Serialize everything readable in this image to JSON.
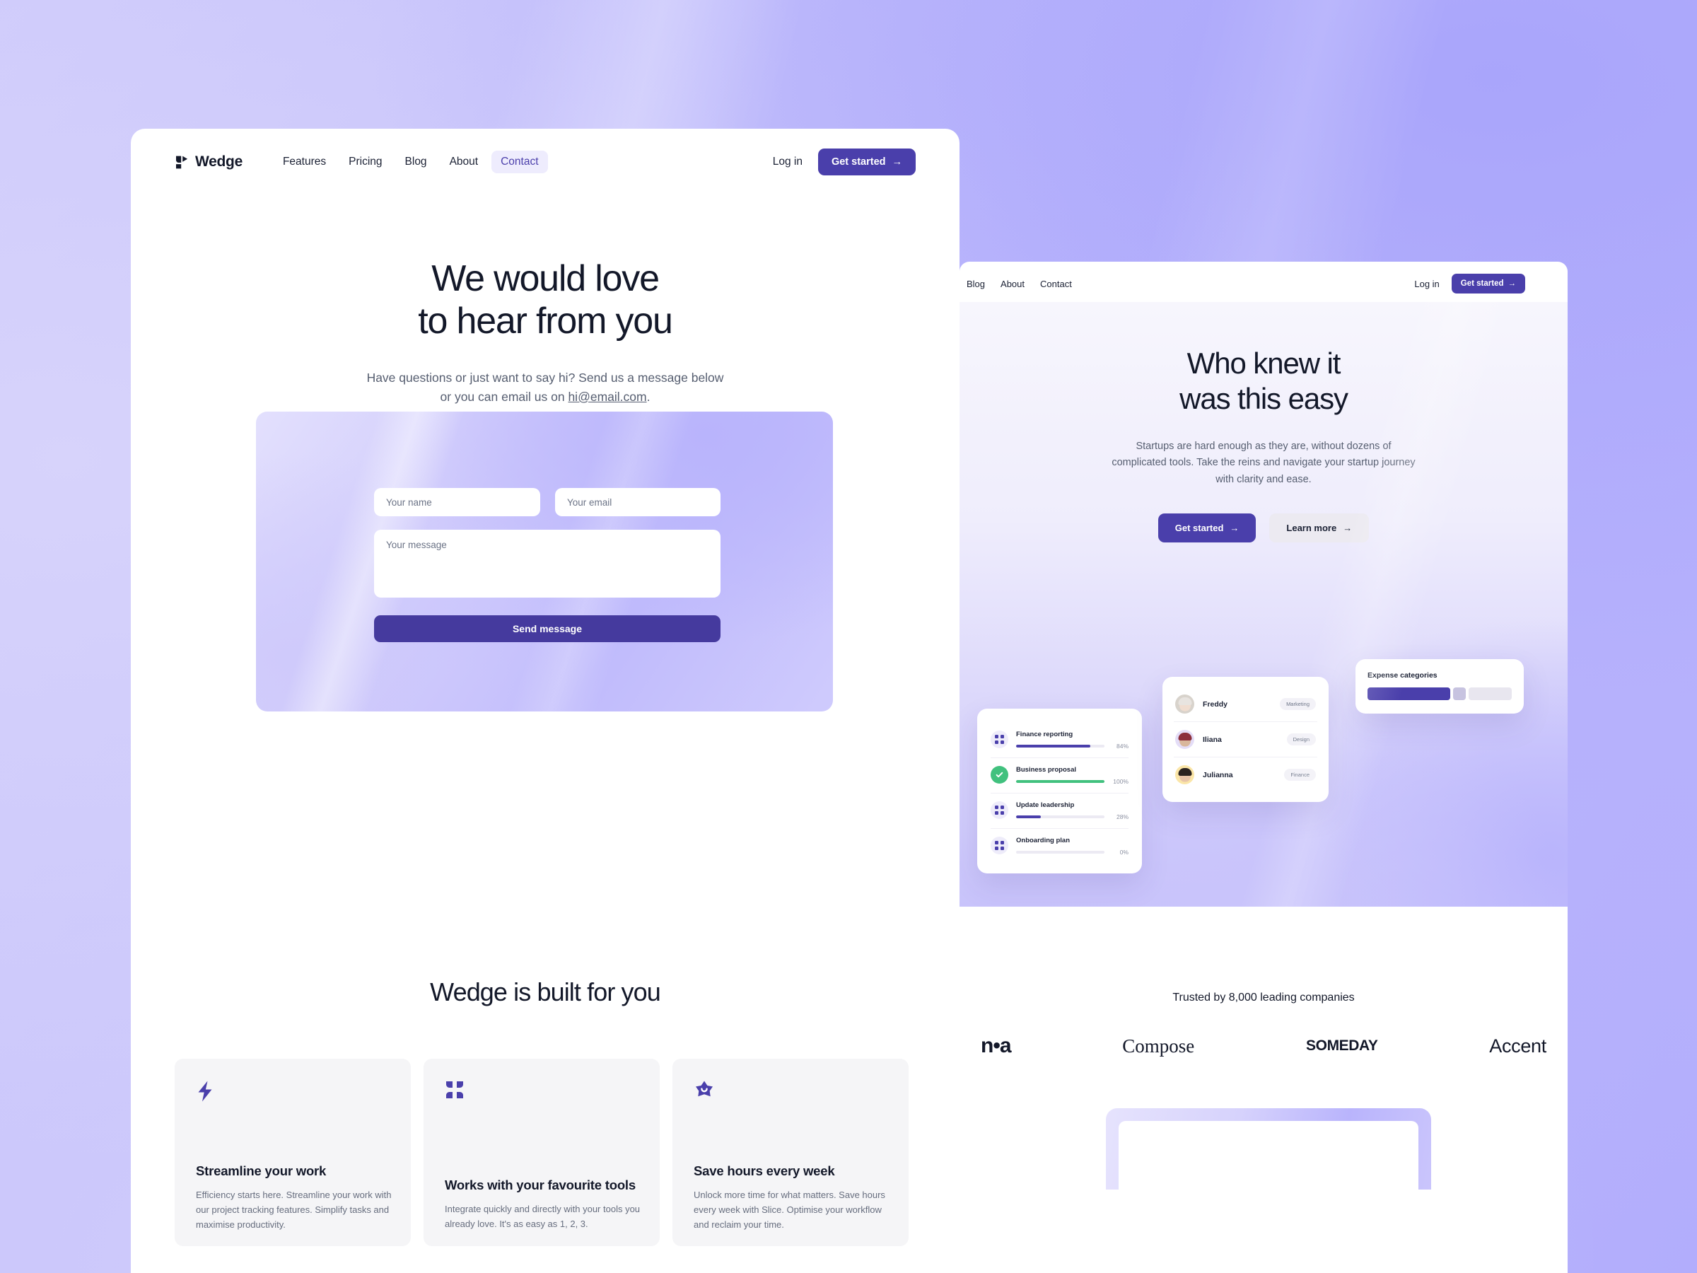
{
  "left_page": {
    "brand": {
      "name": "Wedge",
      "icon": "wedge-logo-icon"
    },
    "nav": [
      {
        "label": "Features",
        "active": false
      },
      {
        "label": "Pricing",
        "active": false
      },
      {
        "label": "Blog",
        "active": false
      },
      {
        "label": "About",
        "active": false
      },
      {
        "label": "Contact",
        "active": true
      }
    ],
    "login_label": "Log in",
    "cta_label": "Get started",
    "cta_arrow": "→",
    "hero": {
      "title_line1": "We would love",
      "title_line2": "to hear from you",
      "sub_line1": "Have questions or just want to say hi? Send us a message below",
      "sub_line2_pre": "or you can email us on ",
      "sub_email": "hi@email.com",
      "sub_line2_post": "."
    },
    "form": {
      "name_placeholder": "Your name",
      "email_placeholder": "Your email",
      "message_placeholder": "Your message",
      "submit_label": "Send message"
    },
    "built_title": "Wedge is built for you",
    "cards": [
      {
        "icon": "lightning-bolt-icon",
        "title": "Streamline your work",
        "body": "Efficiency starts here. Streamline your work with our project tracking features. Simplify tasks and maximise productivity."
      },
      {
        "icon": "four-dots-icon",
        "title": "Works with your favourite tools",
        "body": "Integrate quickly and directly with your tools you already love. It's as easy as 1, 2, 3."
      },
      {
        "icon": "star-smile-icon",
        "title": "Save hours every week",
        "body": "Unlock more time for what matters. Save hours every week with Slice. Optimise your workflow and reclaim your time."
      }
    ]
  },
  "right_page": {
    "nav": [
      {
        "label": "Blog"
      },
      {
        "label": "About"
      },
      {
        "label": "Contact"
      }
    ],
    "login_label": "Log in",
    "cta_label": "Get started",
    "cta_arrow": "→",
    "hero": {
      "title_line1": "Who knew it",
      "title_line2": "was this easy",
      "sub": "Startups are hard enough as they are, without dozens of complicated tools. Take the reins and navigate your startup journey with clarity and ease.",
      "primary_label": "Get started",
      "secondary_label": "Learn more",
      "arrow": "→"
    },
    "tasks_card": {
      "items": [
        {
          "name": "Finance reporting",
          "percent": "84%",
          "value": 84,
          "done": false,
          "icon": "four-dots-icon"
        },
        {
          "name": "Business proposal",
          "percent": "100%",
          "value": 100,
          "done": true,
          "icon": "check-icon"
        },
        {
          "name": "Update leadership",
          "percent": "28%",
          "value": 28,
          "done": false,
          "icon": "four-dots-icon"
        },
        {
          "name": "Onboarding plan",
          "percent": "0%",
          "value": 0,
          "done": false,
          "icon": "four-dots-icon"
        }
      ]
    },
    "people_card": {
      "items": [
        {
          "name": "Freddy",
          "tag": "Marketing",
          "avatar_bg": "#d8d3cc",
          "skin": "#f0ddd0",
          "hair": "#e8e4e0"
        },
        {
          "name": "Iliana",
          "tag": "Design",
          "avatar_bg": "#e4ddf7",
          "skin": "#d9b79c",
          "hair": "#8c2f3c"
        },
        {
          "name": "Julianna",
          "tag": "Finance",
          "avatar_bg": "#fbe6a8",
          "skin": "#e8c4a8",
          "hair": "#2b2320"
        }
      ]
    },
    "expense_card": {
      "title": "Expense categories",
      "segments": [
        {
          "width": "58%",
          "color": "#4a3fab"
        },
        {
          "width": "9%",
          "color": "#c7c3e0"
        },
        {
          "width": "30%",
          "color": "#e8e6ef"
        }
      ]
    },
    "trusted_label": "Trusted by 8,000 leading companies",
    "logos": [
      {
        "text": "n•a",
        "style": "na"
      },
      {
        "text": "Compose",
        "style": "compose"
      },
      {
        "text": "SOMEDAY",
        "style": "someday"
      },
      {
        "text": "Accent",
        "style": "accent"
      }
    ]
  },
  "theme": {
    "accent": "#4a3fab",
    "accent_dark": "#453a9e",
    "ink": "#131829",
    "muted": "#565e70",
    "green": "#41c17e",
    "bg_lavender_light": "#cdc9fb",
    "bg_lavender_deep": "#a9a5fb",
    "card_grey": "#f5f5f7"
  }
}
